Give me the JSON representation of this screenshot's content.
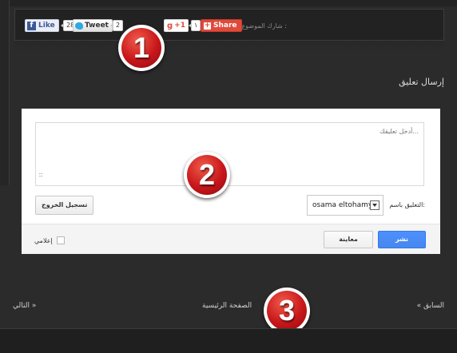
{
  "share_bar": {
    "label": "شارك الموضوع :",
    "facebook": {
      "label": "Like",
      "count": "28"
    },
    "twitter": {
      "label": "Tweet",
      "count": "2"
    },
    "google_plus": {
      "label": "+1",
      "count": "١"
    },
    "share": {
      "label": "Share"
    }
  },
  "badges": [
    "1",
    "2",
    "3"
  ],
  "comment_form": {
    "heading": "إرسال تعليق",
    "textarea_placeholder": "أدخل تعليقك...",
    "resize_hint": ":::",
    "identity_label": "التعليق باسم:",
    "identity_value": "osama eltohamy",
    "logout_label": "تسجيل الخروج",
    "publish_label": "نشر",
    "preview_label": "معاينة",
    "notify_label": "إعلامي"
  },
  "pager": {
    "previous": "« السابق",
    "home": "الصفحة الرئيسية",
    "next": "التالي »"
  },
  "colors": {
    "badge_red": "#c8171b",
    "publish_blue": "#4d90fe",
    "background": "#2b2b2b"
  }
}
